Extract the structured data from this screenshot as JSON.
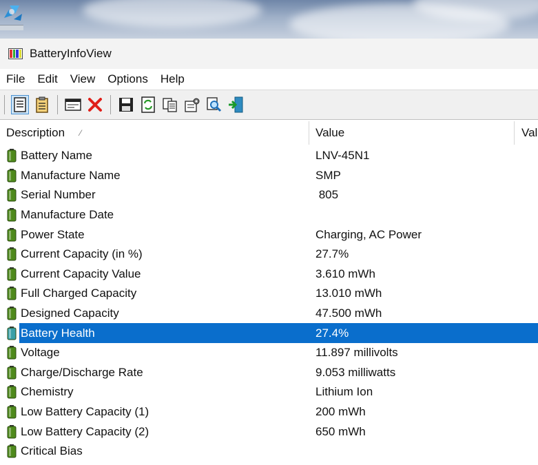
{
  "window": {
    "title": "BatteryInfoView"
  },
  "menu": [
    "File",
    "Edit",
    "View",
    "Options",
    "Help"
  ],
  "toolbar": {
    "buttons": [
      {
        "icon": "properties-icon",
        "pressed": true
      },
      {
        "icon": "clipboard-icon",
        "pressed": false
      },
      {
        "icon": "window-icon",
        "pressed": false
      },
      {
        "icon": "delete-icon",
        "pressed": false
      },
      {
        "icon": "save-icon",
        "pressed": false
      },
      {
        "icon": "refresh-icon",
        "pressed": false
      },
      {
        "icon": "copy-icon",
        "pressed": false
      },
      {
        "icon": "options-icon",
        "pressed": false
      },
      {
        "icon": "find-icon",
        "pressed": false
      },
      {
        "icon": "exit-icon",
        "pressed": false
      }
    ]
  },
  "columns": {
    "description": "Description",
    "value": "Value",
    "value2": "Val"
  },
  "rows": [
    {
      "description": "Battery Name",
      "value": "LNV-45N1"
    },
    {
      "description": "Manufacture Name",
      "value": "SMP"
    },
    {
      "description": "Serial Number",
      "value": " 805"
    },
    {
      "description": "Manufacture Date",
      "value": ""
    },
    {
      "description": "Power State",
      "value": "Charging, AC Power"
    },
    {
      "description": "Current Capacity (in %)",
      "value": "27.7%"
    },
    {
      "description": "Current Capacity Value",
      "value": "3.610 mWh"
    },
    {
      "description": "Full Charged Capacity",
      "value": "13.010 mWh"
    },
    {
      "description": "Designed Capacity",
      "value": "47.500 mWh"
    },
    {
      "description": "Battery Health",
      "value": "27.4%",
      "selected": true
    },
    {
      "description": "Voltage",
      "value": "11.897 millivolts"
    },
    {
      "description": "Charge/Discharge Rate",
      "value": "9.053 milliwatts"
    },
    {
      "description": "Chemistry",
      "value": "Lithium Ion"
    },
    {
      "description": "Low Battery Capacity (1)",
      "value": "200 mWh"
    },
    {
      "description": "Low Battery Capacity (2)",
      "value": "650 mWh"
    },
    {
      "description": "Critical Bias",
      "value": ""
    }
  ],
  "colors": {
    "selection": "#0a6ecc",
    "battery": "#4f8a1c",
    "selected_battery": "#3aa0a8"
  }
}
